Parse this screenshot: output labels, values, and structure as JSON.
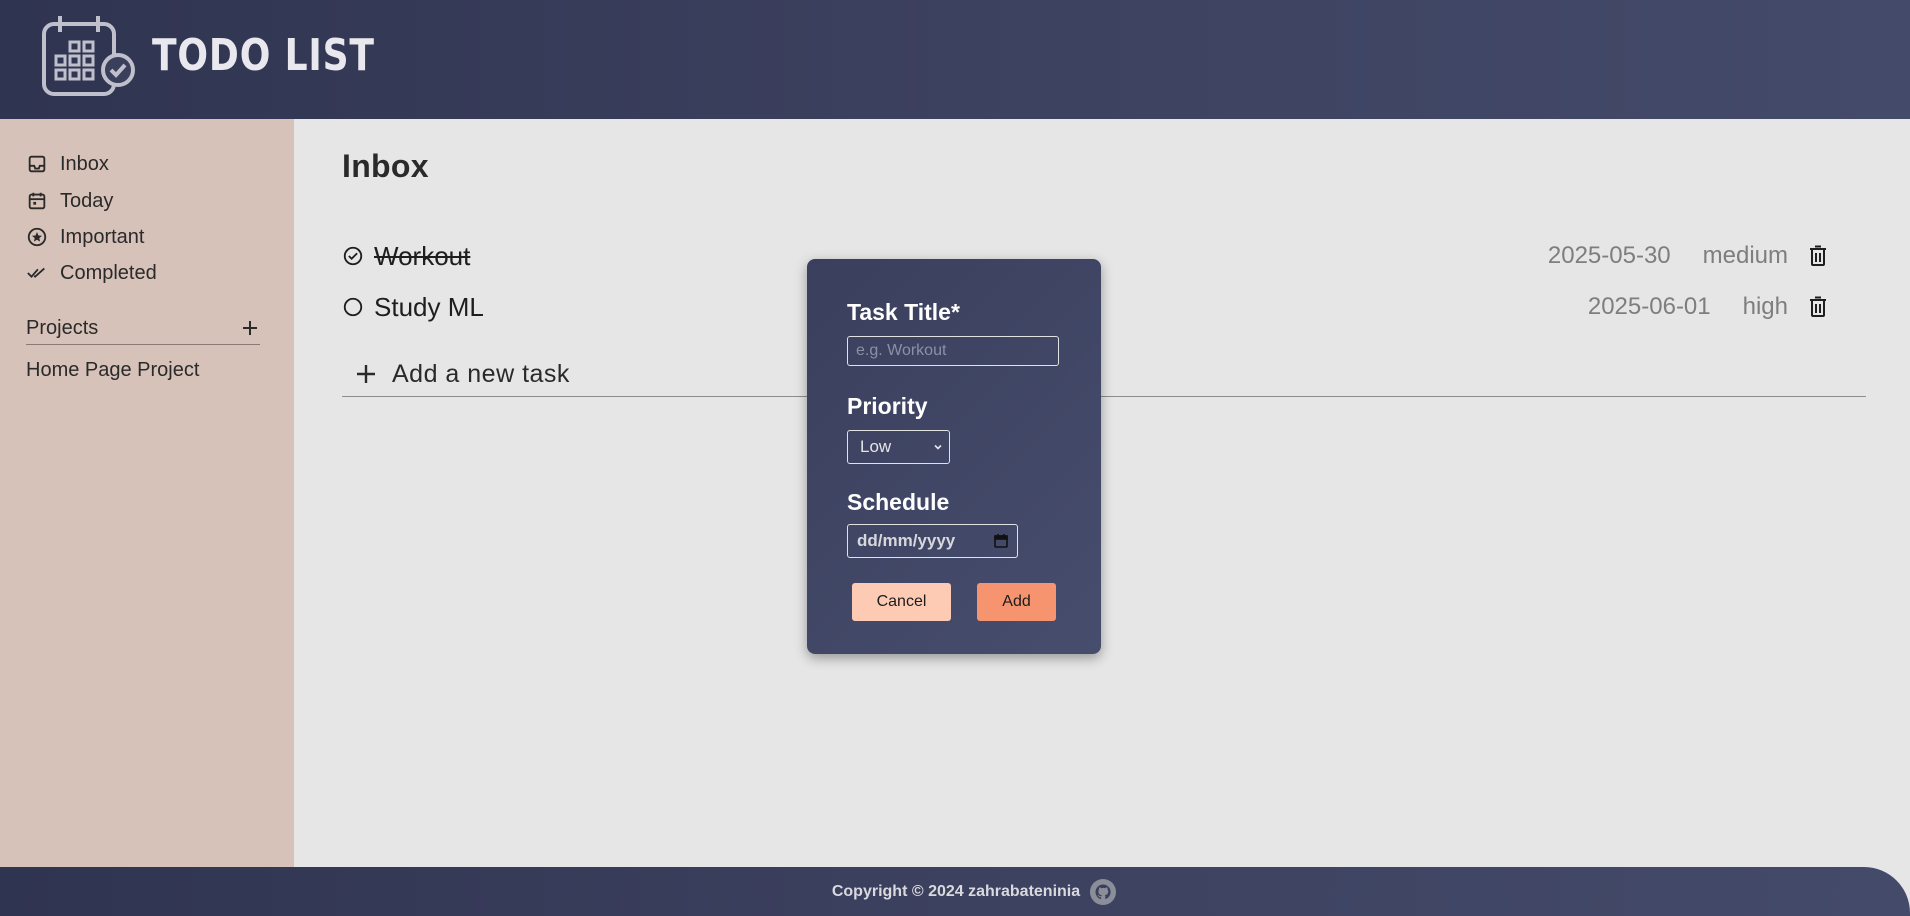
{
  "header": {
    "title": "TODO LIST",
    "logo_icon": "calendar-check-icon"
  },
  "sidebar": {
    "items": [
      {
        "label": "Inbox",
        "icon": "inbox-icon"
      },
      {
        "label": "Today",
        "icon": "calendar-icon"
      },
      {
        "label": "Important",
        "icon": "star-circle-icon"
      },
      {
        "label": "Completed",
        "icon": "double-check-icon"
      }
    ],
    "projects_label": "Projects",
    "projects": [
      {
        "label": "Home Page Project"
      }
    ]
  },
  "main": {
    "title": "Inbox",
    "tasks": [
      {
        "title": "Workout",
        "date": "2025-05-30",
        "priority": "medium",
        "completed": true
      },
      {
        "title": "Study ML",
        "date": "2025-06-01",
        "priority": "high",
        "completed": false
      }
    ],
    "add_task_label": "Add a new task"
  },
  "modal": {
    "title_label": "Task Title*",
    "title_placeholder": "e.g. Workout",
    "title_value": "",
    "priority_label": "Priority",
    "priority_value": "Low",
    "schedule_label": "Schedule",
    "schedule_placeholder": "dd/mm/yyyy",
    "cancel_label": "Cancel",
    "add_label": "Add"
  },
  "footer": {
    "copyright": "Copyright © 2024 zahrabateninia"
  },
  "colors": {
    "header_bg": "#3c415f",
    "sidebar_bg": "#d7c2b9",
    "main_bg": "#e6e6e6",
    "cancel_button": "#fdcab4",
    "add_button": "#f5946f"
  }
}
